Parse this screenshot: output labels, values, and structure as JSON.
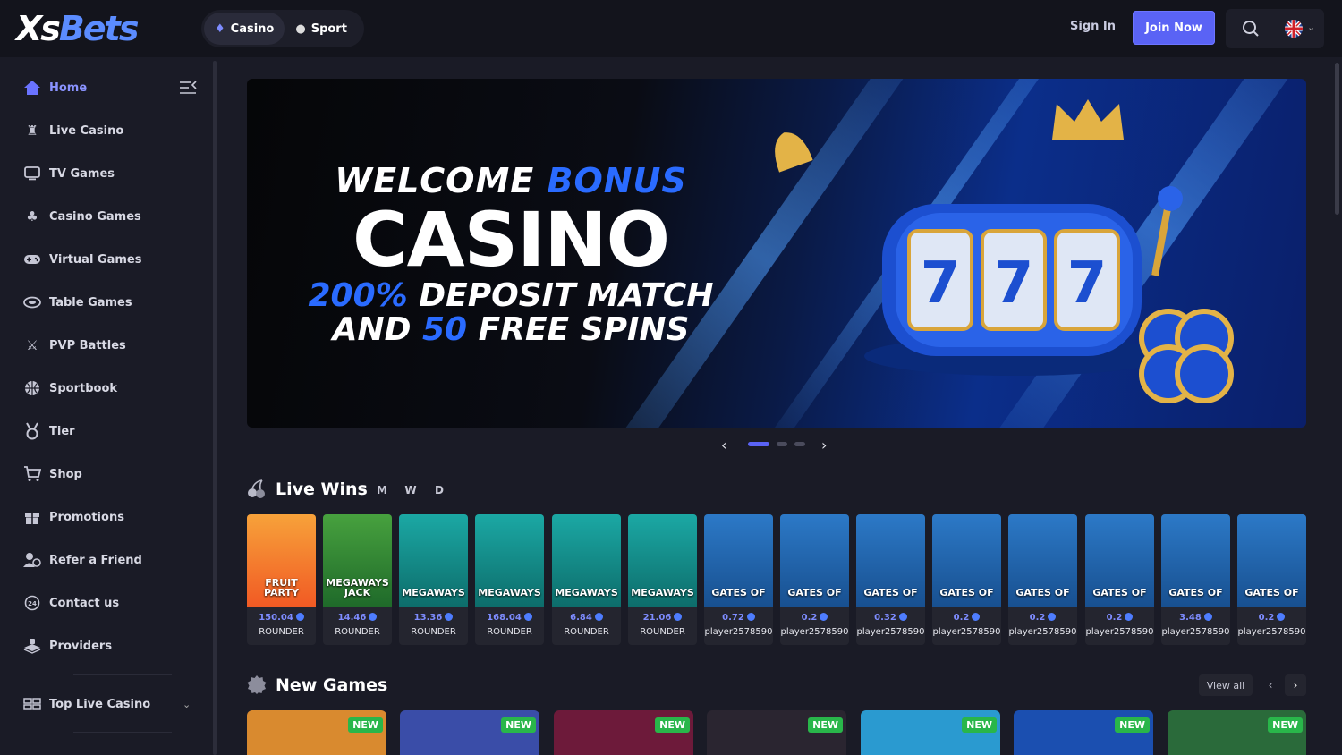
{
  "header": {
    "logo_xs": "Xs",
    "logo_bets": "Bets",
    "modes": [
      {
        "label": "Casino",
        "icon": "casino-icon",
        "active": true
      },
      {
        "label": "Sport",
        "icon": "sport-icon",
        "active": false
      }
    ],
    "sign_in": "Sign In",
    "join_now": "Join Now",
    "accent_color": "#5a63f5"
  },
  "sidebar": {
    "items": [
      {
        "label": "Home",
        "icon": "home-icon",
        "active": true
      },
      {
        "label": "Live Casino",
        "icon": "live-casino-icon"
      },
      {
        "label": "TV Games",
        "icon": "tv-icon"
      },
      {
        "label": "Casino Games",
        "icon": "cherries-icon"
      },
      {
        "label": "Virtual Games",
        "icon": "gamepad-icon"
      },
      {
        "label": "Table Games",
        "icon": "table-icon"
      },
      {
        "label": "PVP Battles",
        "icon": "swords-icon"
      },
      {
        "label": "Sportbook",
        "icon": "basketball-icon"
      },
      {
        "label": "Tier",
        "icon": "medal-icon"
      },
      {
        "label": "Shop",
        "icon": "cart-icon"
      },
      {
        "label": "Promotions",
        "icon": "gift-icon"
      },
      {
        "label": "Refer a Friend",
        "icon": "refer-icon"
      },
      {
        "label": "Contact us",
        "icon": "support-24-icon"
      },
      {
        "label": "Providers",
        "icon": "providers-icon"
      }
    ],
    "top_live_casino": "Top Live Casino"
  },
  "banner": {
    "line1_a": "WELCOME ",
    "line1_b": "BONUS",
    "line2": "CASINO",
    "line3_a": "200%",
    "line3_b": " DEPOSIT MATCH",
    "line4_a": "AND ",
    "line4_b": "50",
    "line4_c": " FREE SPINS",
    "slide_count": 3,
    "active_slide": 1
  },
  "live_wins": {
    "title": "Live Wins",
    "periods": [
      "M",
      "W",
      "D"
    ],
    "items": [
      {
        "game": "FRUIT PARTY",
        "theme": "fruit",
        "amount": "150.04",
        "user": "ROUNDER"
      },
      {
        "game": "MEGAWAYS JACK",
        "theme": "jack",
        "amount": "14.46",
        "user": "ROUNDER"
      },
      {
        "game": "MEGAWAYS",
        "theme": "pirate",
        "amount": "13.36",
        "user": "ROUNDER"
      },
      {
        "game": "MEGAWAYS",
        "theme": "pirate",
        "amount": "168.04",
        "user": "ROUNDER"
      },
      {
        "game": "MEGAWAYS",
        "theme": "pirate",
        "amount": "6.84",
        "user": "ROUNDER"
      },
      {
        "game": "MEGAWAYS",
        "theme": "pirate",
        "amount": "21.06",
        "user": "ROUNDER"
      },
      {
        "game": "GATES OF",
        "theme": "gates",
        "amount": "0.72",
        "user": "player2578590"
      },
      {
        "game": "GATES OF",
        "theme": "gates",
        "amount": "0.2",
        "user": "player2578590"
      },
      {
        "game": "GATES OF",
        "theme": "gates",
        "amount": "0.32",
        "user": "player2578590"
      },
      {
        "game": "GATES OF",
        "theme": "gates",
        "amount": "0.2",
        "user": "player2578590"
      },
      {
        "game": "GATES OF",
        "theme": "gates",
        "amount": "0.2",
        "user": "player2578590"
      },
      {
        "game": "GATES OF",
        "theme": "gates",
        "amount": "0.2",
        "user": "player2578590"
      },
      {
        "game": "GATES OF",
        "theme": "gates",
        "amount": "3.48",
        "user": "player2578590"
      },
      {
        "game": "GATES OF",
        "theme": "gates",
        "amount": "0.2",
        "user": "player2578590"
      }
    ]
  },
  "new_games": {
    "title": "New Games",
    "view_all": "View all",
    "badge": "NEW",
    "cards": [
      "#d98a2f",
      "#3a4da8",
      "#6d1a3a",
      "#2a2530",
      "#2a9ad0",
      "#1b4fb0",
      "#2a6a3a"
    ]
  }
}
